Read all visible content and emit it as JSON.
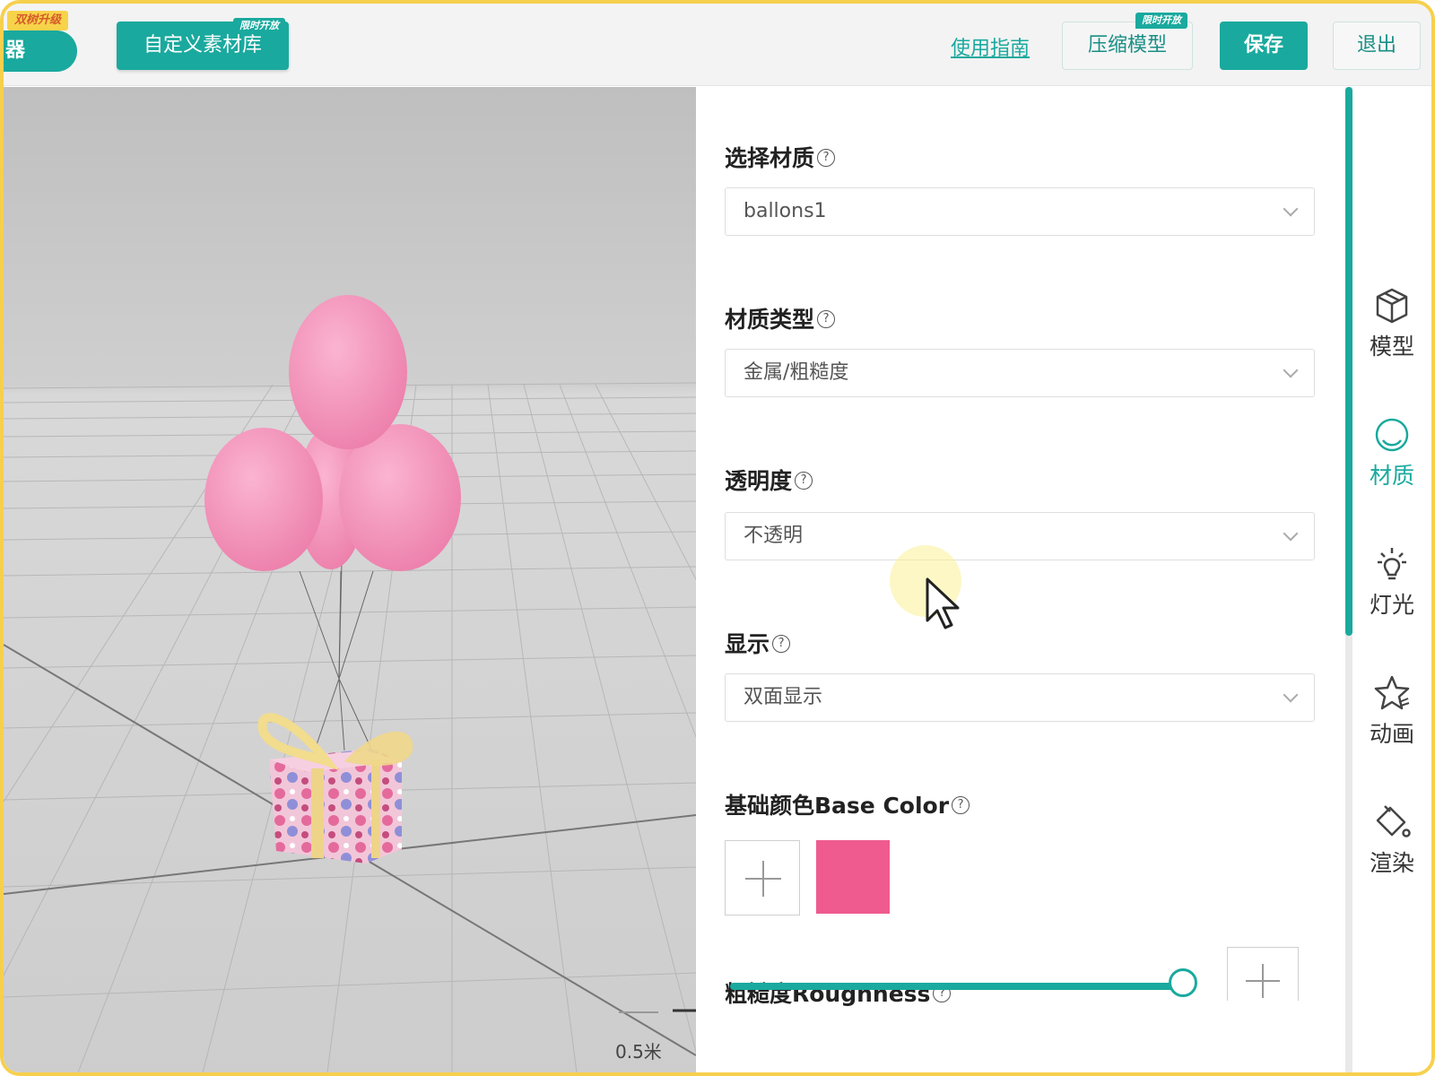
{
  "topbar": {
    "left_badge": "双树升级",
    "left_pill_text": "器",
    "custom_library_label": "自定义素材库",
    "custom_library_badge": "限时开放",
    "guide_link": "使用指南",
    "compress_label": "压缩模型",
    "compress_badge": "限时开放",
    "save_label": "保存",
    "exit_label": "退出"
  },
  "viewport": {
    "scale_label": "0.5米"
  },
  "properties": {
    "material_select": {
      "label": "选择材质",
      "value": "ballons1"
    },
    "material_type": {
      "label": "材质类型",
      "value": "金属/粗糙度"
    },
    "transparency": {
      "label": "透明度",
      "value": "不透明"
    },
    "display": {
      "label": "显示",
      "value": "双面显示"
    },
    "base_color": {
      "label": "基础颜色Base Color",
      "swatch": "#ef5b8f"
    },
    "roughness": {
      "label": "粗糙度Roughness",
      "value_fraction": 0.95
    }
  },
  "help_glyph": "?",
  "tabs": [
    {
      "label": "模型",
      "icon": "cube-icon",
      "active": false
    },
    {
      "label": "材质",
      "icon": "material-sphere-icon",
      "active": true
    },
    {
      "label": "灯光",
      "icon": "light-bulb-icon",
      "active": false
    },
    {
      "label": "动画",
      "icon": "animation-star-icon",
      "active": false
    },
    {
      "label": "渲染",
      "icon": "paint-bucket-icon",
      "active": false
    }
  ],
  "colors": {
    "accent": "#1aa99e",
    "frame": "#f6d04d",
    "balloon": "#f48fb9"
  }
}
